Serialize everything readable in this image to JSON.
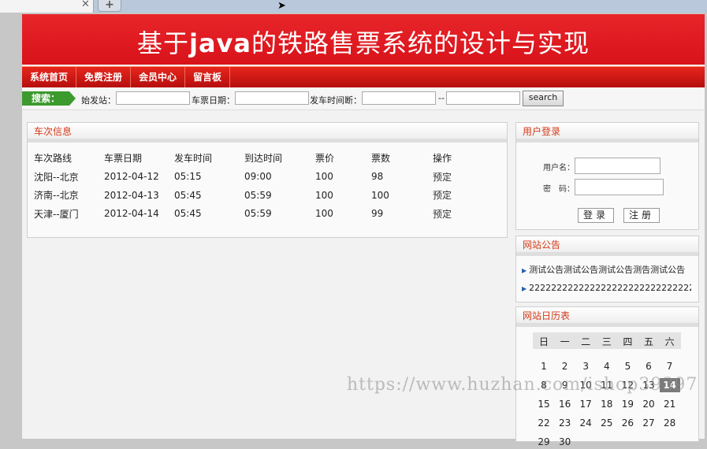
{
  "header": {
    "title_pre": "基于",
    "title_java": "java",
    "title_post": "的铁路售票系统的设计与实现"
  },
  "nav": {
    "items": [
      "系统首页",
      "免费注册",
      "会员中心",
      "留言板"
    ]
  },
  "search": {
    "tag": "搜索：",
    "start_label": "始发站：",
    "date_label": "车票日期：",
    "time_label": "发车时间断：",
    "dash": "--",
    "button": "search"
  },
  "trains": {
    "title": "车次信息",
    "columns": [
      "车次路线",
      "车票日期",
      "发车时间",
      "到达时间",
      "票价",
      "票数",
      "操作"
    ],
    "rows": [
      [
        "沈阳--北京",
        "2012-04-12",
        "05:15",
        "09:00",
        "100",
        "98",
        "预定"
      ],
      [
        "济南--北京",
        "2012-04-13",
        "05:45",
        "05:59",
        "100",
        "100",
        "预定"
      ],
      [
        "天津--厦门",
        "2012-04-14",
        "05:45",
        "05:59",
        "100",
        "99",
        "预定"
      ]
    ]
  },
  "login": {
    "title": "用户登录",
    "user_label": "用户名：",
    "pass_label": "密　码：",
    "login_button": "登录",
    "register_button": "注册"
  },
  "notice": {
    "title": "网站公告",
    "items": [
      "测试公告测试公告测试公告测告测试公告",
      "2222222222222222222222222222222"
    ]
  },
  "calendar": {
    "title": "网站日历表",
    "weekdays": [
      "日",
      "一",
      "二",
      "三",
      "四",
      "五",
      "六"
    ],
    "weeks": [
      [
        "",
        "",
        "",
        "",
        "",
        "",
        ""
      ],
      [
        "1",
        "2",
        "3",
        "4",
        "5",
        "6",
        "7"
      ],
      [
        "8",
        "9",
        "10",
        "11",
        "12",
        "13",
        "14"
      ],
      [
        "15",
        "16",
        "17",
        "18",
        "19",
        "20",
        "21"
      ],
      [
        "22",
        "23",
        "24",
        "25",
        "26",
        "27",
        "28"
      ],
      [
        "29",
        "30",
        "",
        "",
        "",
        "",
        ""
      ]
    ],
    "today": "14"
  },
  "watermark": "https://www.huzhan.com/ishop39397"
}
